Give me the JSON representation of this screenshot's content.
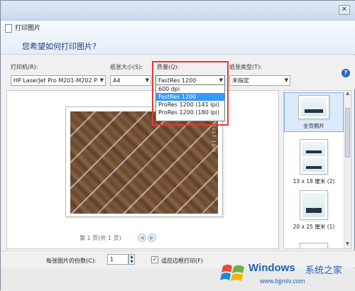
{
  "window": {
    "title": "打印图片",
    "close_glyph": "✕"
  },
  "header": {
    "question": "您希望如何打印图片?"
  },
  "toolbar": {
    "printer_label": "打印机(R):",
    "printer_value": "HP LaserJet Pro M201-M202 P",
    "paper_size_label": "纸张大小(S):",
    "paper_size_value": "A4",
    "quality_label": "质量(Q):",
    "quality_value": "FastRes 1200",
    "paper_type_label": "纸张类型(T):",
    "paper_type_value": "未指定",
    "help_glyph": "?"
  },
  "quality_dropdown": {
    "options": [
      "600 dpi",
      "FastRes 1200",
      "ProRes 1200 (141 lpi)",
      "ProRes 1200 (180 lpi)"
    ],
    "selected_index": 1
  },
  "preview": {
    "photo_stamp": "2017-12-0",
    "page_indicator": "第 1 页(共 1 页)",
    "prev_glyph": "◀",
    "next_glyph": "▶"
  },
  "layouts": [
    {
      "label": "全页照片",
      "selected": true
    },
    {
      "label": "13 x 18 厘米 (2)",
      "selected": false
    },
    {
      "label": "20 x 25 厘米 (1)",
      "selected": false
    }
  ],
  "bottom": {
    "copies_label": "每张图片的份数(C):",
    "copies_value": "1",
    "fit_checked_glyph": "✓",
    "fit_label": "适应边框打印(F)"
  },
  "watermark": {
    "brand": "Windows",
    "brand_cn": "系统之家",
    "url": "www.bjjmlv.com"
  },
  "colors": {
    "accent_blue": "#3399ff",
    "highlight_red": "#e53935",
    "header_text": "#1e3f7a"
  }
}
